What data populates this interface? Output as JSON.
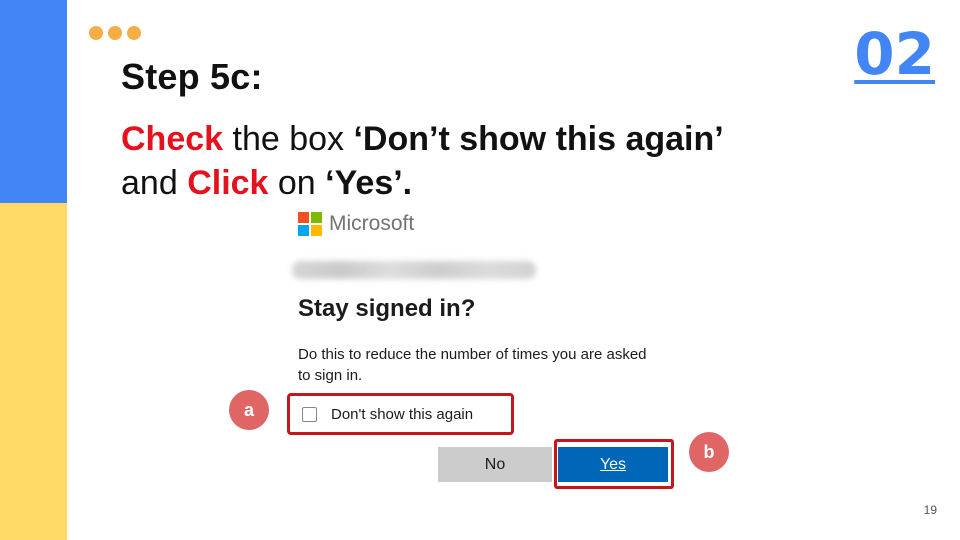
{
  "slide": {
    "step_title": "Step 5c:",
    "slide_number": "02",
    "page_number": "19"
  },
  "instruction": {
    "check": "Check",
    "the_box": " the box ",
    "option_quote": "‘Don’t show this again’",
    "and": "and ",
    "click": "Click",
    "on": " on ",
    "yes_quote": "‘Yes’."
  },
  "dialog": {
    "brand": "Microsoft",
    "heading": "Stay signed in?",
    "body": "Do this to reduce the number of times you are asked to sign in.",
    "checkbox_label": "Don't show this again",
    "checkbox_checked": false,
    "no_button": "No",
    "yes_button": "Yes"
  },
  "markers": {
    "a": "a",
    "b": "b"
  },
  "colors": {
    "blue_accent": "#4285f4",
    "yellow_accent": "#ffd966",
    "dots": "#f6ad45",
    "red_text": "#e5121d",
    "highlight_border": "#c5161d",
    "marker": "#e06666",
    "yes_button": "#0067b8",
    "no_button": "#cccccc"
  }
}
